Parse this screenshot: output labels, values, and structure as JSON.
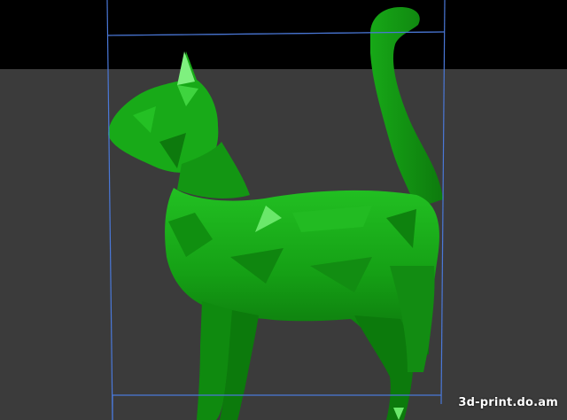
{
  "viewer": {
    "watermark": "3d-print.do.am",
    "model_color": "#16a416",
    "highlight_color": "#5fe85f",
    "shadow_color": "#0a5c0a",
    "bbox_color": "#4a78d8",
    "background_top": "#000000",
    "background_floor": "#3b3b3b"
  },
  "model": {
    "name": "cat-icon"
  }
}
